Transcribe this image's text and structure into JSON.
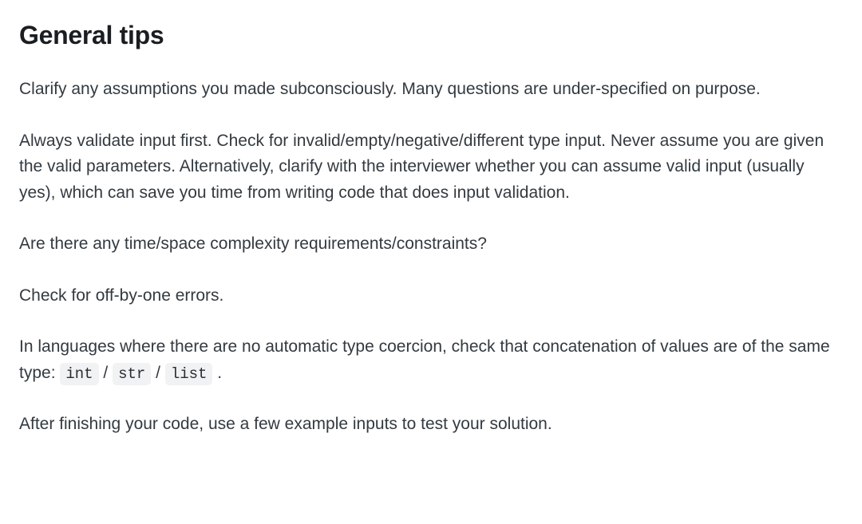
{
  "heading": "General tips",
  "paragraphs": {
    "p1": "Clarify any assumptions you made subconsciously. Many questions are under-specified on purpose.",
    "p2": "Always validate input first. Check for invalid/empty/negative/different type input. Never assume you are given the valid parameters. Alternatively, clarify with the interviewer whether you can assume valid input (usually yes), which can save you time from writing code that does input validation.",
    "p3": "Are there any time/space complexity requirements/constraints?",
    "p4": "Check for off-by-one errors.",
    "p5_pre": "In languages where there are no automatic type coercion, check that concatenation of values are of the same type: ",
    "p5_code1": "int",
    "p5_sep1": " / ",
    "p5_code2": "str",
    "p5_sep2": " / ",
    "p5_code3": "list",
    "p5_post": " .",
    "p6": "After finishing your code, use a few example inputs to test your solution."
  }
}
